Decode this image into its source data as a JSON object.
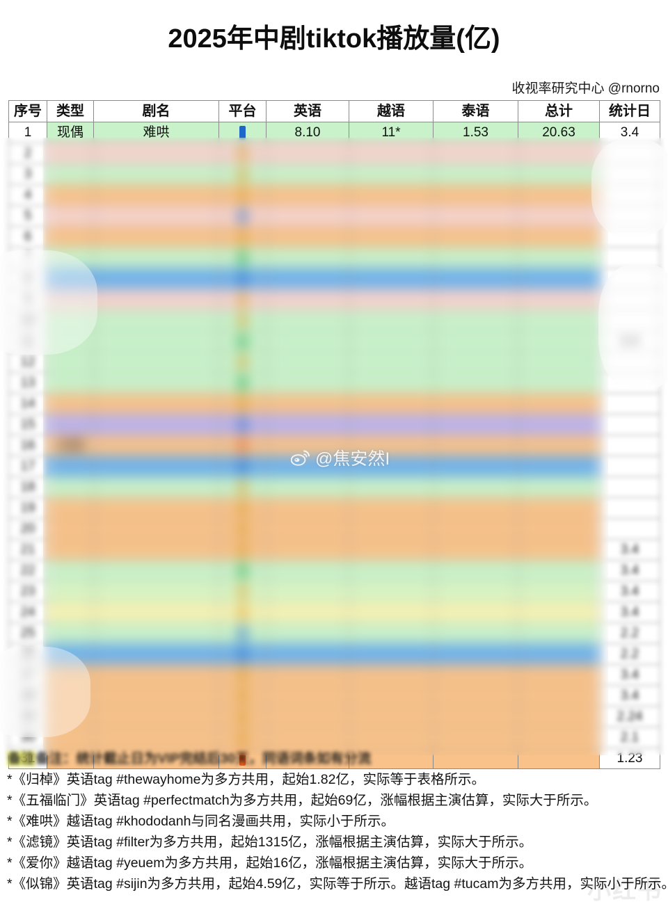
{
  "title": "2025年中剧tiktok播放量(亿)",
  "attribution": "收视率研究中心 @rnorno",
  "table": {
    "headers": [
      {
        "key": "index",
        "label": "序号"
      },
      {
        "key": "type",
        "label": "类型"
      },
      {
        "key": "name",
        "label": "剧名"
      },
      {
        "key": "platform",
        "label": "平台"
      },
      {
        "key": "english",
        "label": "英语"
      },
      {
        "key": "viet",
        "label": "越语"
      },
      {
        "key": "thai",
        "label": "泰语"
      },
      {
        "key": "total",
        "label": "总计"
      },
      {
        "key": "date",
        "label": "统计日"
      }
    ],
    "rows": [
      {
        "index": "1",
        "type": "现偶",
        "name": "难哄",
        "platform": "youku",
        "english": "8.10",
        "viet": "11*",
        "thai": "1.53",
        "total": "20.63",
        "date": "3.4",
        "band": "bg-green",
        "visible": true
      },
      {
        "index": "2",
        "type": "",
        "name": "",
        "platform": "tencent",
        "english": "",
        "viet": "",
        "thai": "",
        "total": "",
        "date": "",
        "band": "bg-pink",
        "visible": false
      },
      {
        "index": "3",
        "type": "",
        "name": "",
        "platform": "tencent",
        "english": "",
        "viet": "",
        "thai": "",
        "total": "",
        "date": "",
        "band": "bg-green",
        "visible": false
      },
      {
        "index": "4",
        "type": "",
        "name": "",
        "platform": "tencent",
        "english": "",
        "viet": "",
        "thai": "",
        "total": "",
        "date": "",
        "band": "bg-orange",
        "visible": false
      },
      {
        "index": "5",
        "type": "",
        "name": "",
        "platform": "youku",
        "english": "",
        "viet": "",
        "thai": "",
        "total": "",
        "date": "",
        "band": "bg-pink",
        "visible": false
      },
      {
        "index": "6",
        "type": "",
        "name": "",
        "platform": "tencent",
        "english": "",
        "viet": "",
        "thai": "",
        "total": "",
        "date": "",
        "band": "bg-orange",
        "visible": false
      },
      {
        "index": "7",
        "type": "",
        "name": "",
        "platform": "iqiyi",
        "english": "",
        "viet": "",
        "thai": "",
        "total": "",
        "date": "",
        "band": "bg-green",
        "visible": false
      },
      {
        "index": "8",
        "type": "",
        "name": "",
        "platform": "youku",
        "english": "",
        "viet": "",
        "thai": "",
        "total": "",
        "date": "",
        "band": "bg-blue",
        "visible": false
      },
      {
        "index": "9",
        "type": "",
        "name": "",
        "platform": "tencent",
        "english": "",
        "viet": "",
        "thai": "",
        "total": "",
        "date": "",
        "band": "bg-pink",
        "visible": false
      },
      {
        "index": "10",
        "type": "",
        "name": "",
        "platform": "tencent",
        "english": "",
        "viet": "",
        "thai": "",
        "total": "",
        "date": "",
        "band": "bg-green",
        "visible": false
      },
      {
        "index": "11",
        "type": "",
        "name": "",
        "platform": "iqiyi",
        "english": "",
        "viet": "",
        "thai": "",
        "total": "",
        "date": "3.4",
        "band": "bg-green",
        "visible": false
      },
      {
        "index": "12",
        "type": "",
        "name": "",
        "platform": "tencent",
        "english": "",
        "viet": "",
        "thai": "",
        "total": "",
        "date": "",
        "band": "bg-green",
        "visible": false
      },
      {
        "index": "13",
        "type": "",
        "name": "",
        "platform": "iqiyi",
        "english": "",
        "viet": "",
        "thai": "",
        "total": "",
        "date": "",
        "band": "bg-green",
        "visible": false
      },
      {
        "index": "14",
        "type": "",
        "name": "",
        "platform": "tencent",
        "english": "",
        "viet": "",
        "thai": "",
        "total": "",
        "date": "",
        "band": "bg-orange",
        "visible": false
      },
      {
        "index": "15",
        "type": "",
        "name": "",
        "platform": "youku",
        "english": "",
        "viet": "",
        "thai": "",
        "total": "",
        "date": "",
        "band": "bg-purple",
        "visible": false
      },
      {
        "index": "16",
        "type": "白值",
        "name": "",
        "platform": "mango",
        "english": "",
        "viet": "",
        "thai": "",
        "total": "",
        "date": "",
        "band": "bg-orange",
        "visible": false
      },
      {
        "index": "17",
        "type": "",
        "name": "",
        "platform": "youku",
        "english": "",
        "viet": "",
        "thai": "",
        "total": "",
        "date": "",
        "band": "bg-blue",
        "visible": false
      },
      {
        "index": "18",
        "type": "",
        "name": "",
        "platform": "tencent",
        "english": "",
        "viet": "",
        "thai": "",
        "total": "",
        "date": "",
        "band": "bg-green",
        "visible": false
      },
      {
        "index": "19",
        "type": "",
        "name": "",
        "platform": "tencent",
        "english": "",
        "viet": "",
        "thai": "",
        "total": "",
        "date": "",
        "band": "bg-orange",
        "visible": false
      },
      {
        "index": "20",
        "type": "",
        "name": "",
        "platform": "tencent",
        "english": "",
        "viet": "",
        "thai": "",
        "total": "",
        "date": "",
        "band": "bg-orange",
        "visible": false
      },
      {
        "index": "21",
        "type": "",
        "name": "",
        "platform": "tencent",
        "english": "",
        "viet": "",
        "thai": "",
        "total": "",
        "date": "3.4",
        "band": "bg-orange",
        "visible": false
      },
      {
        "index": "22",
        "type": "",
        "name": "",
        "platform": "iqiyi",
        "english": "",
        "viet": "",
        "thai": "",
        "total": "",
        "date": "3.4",
        "band": "bg-green",
        "visible": false
      },
      {
        "index": "23",
        "type": "",
        "name": "",
        "platform": "tencent",
        "english": "",
        "viet": "",
        "thai": "",
        "total": "",
        "date": "3.4",
        "band": "bg-lgreen",
        "visible": false
      },
      {
        "index": "24",
        "type": "",
        "name": "",
        "platform": "tencent",
        "english": "",
        "viet": "",
        "thai": "",
        "total": "",
        "date": "3.4",
        "band": "bg-yellow",
        "visible": false
      },
      {
        "index": "25",
        "type": "",
        "name": "",
        "platform": "youku",
        "english": "",
        "viet": "",
        "thai": "",
        "total": "",
        "date": "2.2",
        "band": "bg-green",
        "visible": false
      },
      {
        "index": "26",
        "type": "",
        "name": "",
        "platform": "youku",
        "english": "",
        "viet": "",
        "thai": "",
        "total": "",
        "date": "2.2",
        "band": "bg-blue",
        "visible": false
      },
      {
        "index": "27",
        "type": "",
        "name": "",
        "platform": "tencent",
        "english": "",
        "viet": "",
        "thai": "",
        "total": "",
        "date": "3.4",
        "band": "bg-orange",
        "visible": false
      },
      {
        "index": "28",
        "type": "",
        "name": "",
        "platform": "tencent",
        "english": "",
        "viet": "",
        "thai": "",
        "total": "",
        "date": "3.4",
        "band": "bg-orange",
        "visible": false
      },
      {
        "index": "29",
        "type": "",
        "name": "",
        "platform": "tencent",
        "english": "",
        "viet": "",
        "thai": "",
        "total": "",
        "date": "2.24",
        "band": "bg-orange",
        "visible": false
      },
      {
        "index": "30",
        "type": "",
        "name": "",
        "platform": "tencent",
        "english": "",
        "viet": "",
        "thai": "",
        "total": "",
        "date": "2.1",
        "band": "bg-orange",
        "visible": false
      },
      {
        "index": "31",
        "type": "",
        "name": "",
        "platform": "mango",
        "english": "",
        "viet": "",
        "thai": "",
        "total": "",
        "date": "1.23",
        "band": "bg-orange",
        "visible": false
      }
    ]
  },
  "watermark": {
    "weibo_handle": "@焦安然I",
    "corner_text": "小红书"
  },
  "notes": {
    "masked_note": "备注：统计截止日为VIP完结后30天，同语词条如有分流",
    "masked_note_highlight": "备注",
    "lines": [
      "*《归棹》英语tag #thewayhome为多方共用，起始1.82亿，实际等于表格所示。",
      "*《五福临门》英语tag #perfectmatch为多方共用，起始69亿，涨幅根据主演估算，实际大于所示。",
      "*《难哄》越语tag #khododanh与同名漫画共用，实际小于所示。",
      "*《滤镜》英语tag #filter为多方共用，起始1315亿，涨幅根据主演估算，实际大于所示。",
      "*《爱你》越语tag #yeuem为多方共用，起始16亿，涨幅根据主演估算，实际大于所示。",
      "*《似锦》英语tag #sijin为多方共用，起始4.59亿，实际等于所示。越语tag #tucam为多方共用，实际小于所示。"
    ]
  },
  "colors": {
    "band_green": "#c9f2ca",
    "band_orange": "#f8c28a",
    "band_blue": "#6fb2ec",
    "band_purple": "#b9b3ef",
    "highlight_yellow": "#f3f36a",
    "platform_youku": "#1f66c9"
  }
}
